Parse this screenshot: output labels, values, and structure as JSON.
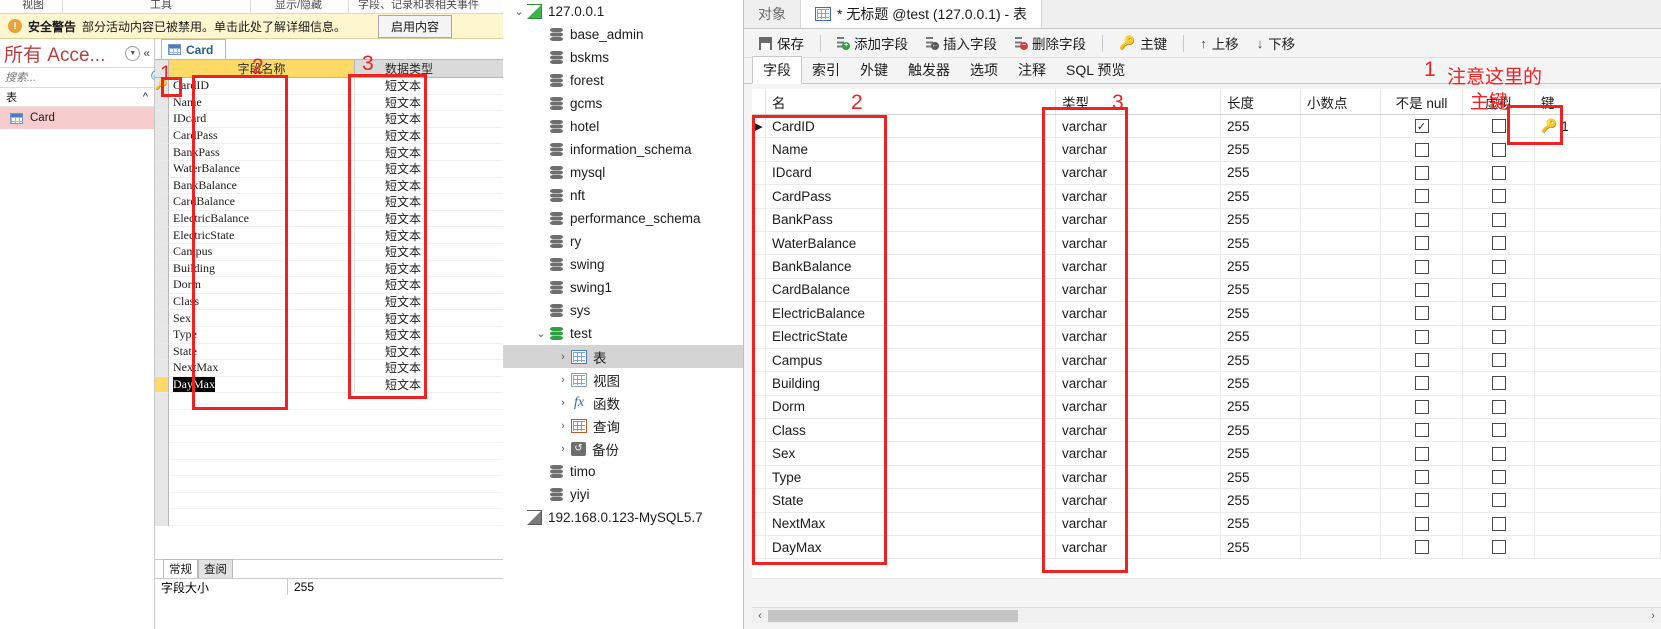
{
  "access": {
    "ribbon_tabs": [
      "视图",
      "工具",
      "显示/隐藏",
      "字段、记录和表相关事件"
    ],
    "security_bar": {
      "icon": "warning-icon",
      "title": "安全警告",
      "message": "部分活动内容已被禁用。单击此处了解详细信息。",
      "button": "启用内容"
    },
    "nav": {
      "title": "所有 Acce...",
      "search_placeholder": "搜索...",
      "group_label": "表",
      "items": [
        {
          "label": "Card",
          "icon": "table-icon",
          "selected": true
        }
      ]
    },
    "doc_tab": {
      "label": "Card",
      "icon": "table-icon"
    },
    "grid": {
      "headers": {
        "selector": "",
        "name": "字段名称",
        "type": "数据类型"
      },
      "rows": [
        {
          "name": "CardID",
          "type": "短文本",
          "key": true
        },
        {
          "name": "Name",
          "type": "短文本",
          "key": false
        },
        {
          "name": "IDcard",
          "type": "短文本",
          "key": false
        },
        {
          "name": "CardPass",
          "type": "短文本",
          "key": false
        },
        {
          "name": "BankPass",
          "type": "短文本",
          "key": false
        },
        {
          "name": "WaterBalance",
          "type": "短文本",
          "key": false
        },
        {
          "name": "BankBalance",
          "type": "短文本",
          "key": false
        },
        {
          "name": "CardBalance",
          "type": "短文本",
          "key": false
        },
        {
          "name": "ElectricBalance",
          "type": "短文本",
          "key": false
        },
        {
          "name": "ElectricState",
          "type": "短文本",
          "key": false
        },
        {
          "name": "Campus",
          "type": "短文本",
          "key": false
        },
        {
          "name": "Building",
          "type": "短文本",
          "key": false
        },
        {
          "name": "Dorm",
          "type": "短文本",
          "key": false
        },
        {
          "name": "Class",
          "type": "短文本",
          "key": false
        },
        {
          "name": "Sex",
          "type": "短文本",
          "key": false
        },
        {
          "name": "Type",
          "type": "短文本",
          "key": false
        },
        {
          "name": "State",
          "type": "短文本",
          "key": false
        },
        {
          "name": "NextMax",
          "type": "短文本",
          "key": false
        },
        {
          "name": "DayMax",
          "type": "短文本",
          "key": false,
          "selected": true
        }
      ]
    },
    "properties": {
      "tabs": [
        {
          "label": "常规",
          "active": true
        },
        {
          "label": "查阅",
          "active": false
        }
      ],
      "rows": [
        {
          "key": "字段大小",
          "value": "255"
        }
      ]
    }
  },
  "tree": {
    "nodes": [
      {
        "label": "127.0.0.1",
        "icon": "connection-icon",
        "indent": 0,
        "expander": "expanded"
      },
      {
        "label": "base_admin",
        "icon": "database-icon",
        "indent": 1
      },
      {
        "label": "bskms",
        "icon": "database-icon",
        "indent": 1
      },
      {
        "label": "forest",
        "icon": "database-icon",
        "indent": 1
      },
      {
        "label": "gcms",
        "icon": "database-icon",
        "indent": 1
      },
      {
        "label": "hotel",
        "icon": "database-icon",
        "indent": 1
      },
      {
        "label": "information_schema",
        "icon": "database-icon",
        "indent": 1
      },
      {
        "label": "mysql",
        "icon": "database-icon",
        "indent": 1
      },
      {
        "label": "nft",
        "icon": "database-icon",
        "indent": 1
      },
      {
        "label": "performance_schema",
        "icon": "database-icon",
        "indent": 1
      },
      {
        "label": "ry",
        "icon": "database-icon",
        "indent": 1
      },
      {
        "label": "swing",
        "icon": "database-icon",
        "indent": 1
      },
      {
        "label": "swing1",
        "icon": "database-icon",
        "indent": 1
      },
      {
        "label": "sys",
        "icon": "database-icon",
        "indent": 1
      },
      {
        "label": "test",
        "icon": "database-open-icon",
        "indent": 1,
        "expander": "expanded"
      },
      {
        "label": "表",
        "icon": "tables-folder-icon",
        "indent": 2,
        "expander": "collapsed",
        "selected": true
      },
      {
        "label": "视图",
        "icon": "views-folder-icon",
        "indent": 2,
        "expander": "collapsed"
      },
      {
        "label": "函数",
        "icon": "functions-folder-icon",
        "indent": 2,
        "expander": "collapsed"
      },
      {
        "label": "查询",
        "icon": "queries-folder-icon",
        "indent": 2,
        "expander": "collapsed"
      },
      {
        "label": "备份",
        "icon": "backups-folder-icon",
        "indent": 2,
        "expander": "collapsed"
      },
      {
        "label": "timo",
        "icon": "database-icon",
        "indent": 1
      },
      {
        "label": "yiyi",
        "icon": "database-icon",
        "indent": 1
      },
      {
        "label": "192.168.0.123-MySQL5.7",
        "icon": "connection-offline-icon",
        "indent": 0
      }
    ]
  },
  "navicat": {
    "window_tabs": [
      {
        "label": "对象",
        "active": false,
        "icon": null
      },
      {
        "label": "* 无标题 @test (127.0.0.1) - 表",
        "active": true,
        "icon": "table-designer-icon"
      }
    ],
    "toolbar": [
      {
        "label": "保存",
        "icon": "save-icon"
      },
      {
        "label": "添加字段",
        "icon": "add-field-icon"
      },
      {
        "label": "插入字段",
        "icon": "insert-field-icon"
      },
      {
        "label": "删除字段",
        "icon": "delete-field-icon"
      },
      {
        "label": "主键",
        "icon": "primary-key-icon"
      },
      {
        "label": "上移",
        "icon": "arrow-up-icon"
      },
      {
        "label": "下移",
        "icon": "arrow-down-icon"
      }
    ],
    "subtabs": [
      {
        "label": "字段",
        "active": true
      },
      {
        "label": "索引",
        "active": false
      },
      {
        "label": "外键",
        "active": false
      },
      {
        "label": "触发器",
        "active": false
      },
      {
        "label": "选项",
        "active": false
      },
      {
        "label": "注释",
        "active": false
      },
      {
        "label": "SQL 预览",
        "active": false
      }
    ],
    "grid": {
      "headers": [
        "名",
        "类型",
        "长度",
        "小数点",
        "不是 null",
        "虚拟",
        "键"
      ],
      "rows": [
        {
          "name": "CardID",
          "type": "varchar",
          "length": "255",
          "decimals": "",
          "not_null": true,
          "virtual": false,
          "key": "1",
          "current": true
        },
        {
          "name": "Name",
          "type": "varchar",
          "length": "255",
          "decimals": "",
          "not_null": false,
          "virtual": false,
          "key": ""
        },
        {
          "name": "IDcard",
          "type": "varchar",
          "length": "255",
          "decimals": "",
          "not_null": false,
          "virtual": false,
          "key": ""
        },
        {
          "name": "CardPass",
          "type": "varchar",
          "length": "255",
          "decimals": "",
          "not_null": false,
          "virtual": false,
          "key": ""
        },
        {
          "name": "BankPass",
          "type": "varchar",
          "length": "255",
          "decimals": "",
          "not_null": false,
          "virtual": false,
          "key": ""
        },
        {
          "name": "WaterBalance",
          "type": "varchar",
          "length": "255",
          "decimals": "",
          "not_null": false,
          "virtual": false,
          "key": ""
        },
        {
          "name": "BankBalance",
          "type": "varchar",
          "length": "255",
          "decimals": "",
          "not_null": false,
          "virtual": false,
          "key": ""
        },
        {
          "name": "CardBalance",
          "type": "varchar",
          "length": "255",
          "decimals": "",
          "not_null": false,
          "virtual": false,
          "key": ""
        },
        {
          "name": "ElectricBalance",
          "type": "varchar",
          "length": "255",
          "decimals": "",
          "not_null": false,
          "virtual": false,
          "key": ""
        },
        {
          "name": "ElectricState",
          "type": "varchar",
          "length": "255",
          "decimals": "",
          "not_null": false,
          "virtual": false,
          "key": ""
        },
        {
          "name": "Campus",
          "type": "varchar",
          "length": "255",
          "decimals": "",
          "not_null": false,
          "virtual": false,
          "key": ""
        },
        {
          "name": "Building",
          "type": "varchar",
          "length": "255",
          "decimals": "",
          "not_null": false,
          "virtual": false,
          "key": ""
        },
        {
          "name": "Dorm",
          "type": "varchar",
          "length": "255",
          "decimals": "",
          "not_null": false,
          "virtual": false,
          "key": ""
        },
        {
          "name": "Class",
          "type": "varchar",
          "length": "255",
          "decimals": "",
          "not_null": false,
          "virtual": false,
          "key": ""
        },
        {
          "name": "Sex",
          "type": "varchar",
          "length": "255",
          "decimals": "",
          "not_null": false,
          "virtual": false,
          "key": ""
        },
        {
          "name": "Type",
          "type": "varchar",
          "length": "255",
          "decimals": "",
          "not_null": false,
          "virtual": false,
          "key": ""
        },
        {
          "name": "State",
          "type": "varchar",
          "length": "255",
          "decimals": "",
          "not_null": false,
          "virtual": false,
          "key": ""
        },
        {
          "name": "NextMax",
          "type": "varchar",
          "length": "255",
          "decimals": "",
          "not_null": false,
          "virtual": false,
          "key": ""
        },
        {
          "name": "DayMax",
          "type": "varchar",
          "length": "255",
          "decimals": "",
          "not_null": false,
          "virtual": false,
          "key": ""
        }
      ]
    },
    "scrollbar": {
      "left_arrow": "‹",
      "right_arrow": "›"
    }
  },
  "annotations": {
    "color": "#ee2222",
    "marks": [
      {
        "id": "n1-left",
        "label": "1"
      },
      {
        "id": "n2-left",
        "label": "2"
      },
      {
        "id": "n3-left",
        "label": "3"
      },
      {
        "id": "n1-right",
        "label": "1"
      },
      {
        "id": "n2-right",
        "label": "2"
      },
      {
        "id": "n3-right",
        "label": "3"
      }
    ],
    "note": "注意这里的主键",
    "note_line1": "注意这里的",
    "note_line2": "主键"
  }
}
